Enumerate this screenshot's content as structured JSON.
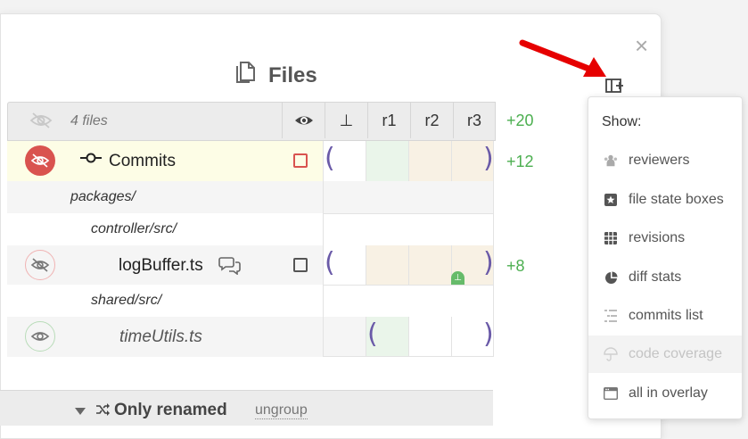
{
  "dialog": {
    "title": "Files",
    "close_glyph": "×"
  },
  "table": {
    "header": {
      "file_count": "4 files",
      "col_base": "⊥",
      "revisions": [
        "r1",
        "r2",
        "r3"
      ],
      "total_stat": "+20"
    },
    "commits_row": {
      "label": "Commits",
      "stat": "+12"
    },
    "dirs": {
      "packages": "packages/",
      "controller": "controller/src/",
      "shared": "shared/src/"
    },
    "files": [
      {
        "name": "logBuffer.ts",
        "stat": "+8",
        "badge": "⊥"
      },
      {
        "name": "timeUtils.ts",
        "stat": ""
      }
    ]
  },
  "menu": {
    "heading": "Show:",
    "items": [
      {
        "label": "reviewers",
        "icon": "users-icon",
        "enabled": true
      },
      {
        "label": "file state boxes",
        "icon": "star-box-icon",
        "enabled": true
      },
      {
        "label": "revisions",
        "icon": "grid-icon",
        "enabled": true
      },
      {
        "label": "diff stats",
        "icon": "pie-icon",
        "enabled": true
      },
      {
        "label": "commits list",
        "icon": "list-tree-icon",
        "enabled": true
      },
      {
        "label": "code coverage",
        "icon": "umbrella-icon",
        "enabled": false
      },
      {
        "label": "all in overlay",
        "icon": "window-icon",
        "enabled": true
      }
    ]
  },
  "group": {
    "label": "Only renamed",
    "ungroup": "ungroup"
  },
  "colors": {
    "accent_green": "#4caf50",
    "bracket_purple": "#6a5aa8",
    "alert_red": "#d9534f",
    "arrow_red": "#e60000"
  }
}
